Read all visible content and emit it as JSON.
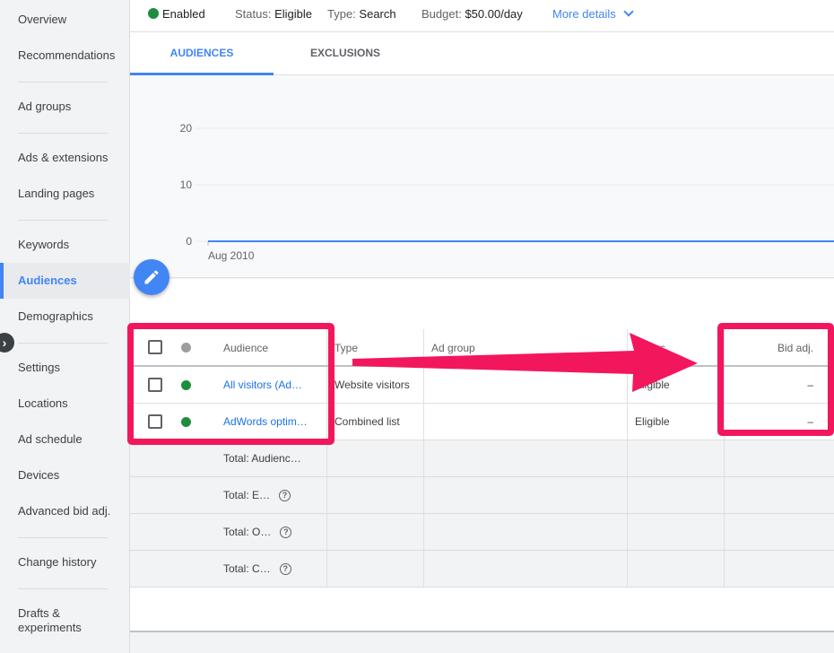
{
  "sidebar": {
    "items": [
      {
        "label": "Overview",
        "active": false
      },
      {
        "label": "Recommendations",
        "active": false
      },
      {
        "label": "Ad groups",
        "active": false
      },
      {
        "label": "Ads & extensions",
        "active": false
      },
      {
        "label": "Landing pages",
        "active": false
      },
      {
        "label": "Keywords",
        "active": false
      },
      {
        "label": "Audiences",
        "active": true
      },
      {
        "label": "Demographics",
        "active": false
      },
      {
        "label": "Settings",
        "active": false
      },
      {
        "label": "Locations",
        "active": false
      },
      {
        "label": "Ad schedule",
        "active": false
      },
      {
        "label": "Devices",
        "active": false
      },
      {
        "label": "Advanced bid adj.",
        "active": false
      },
      {
        "label": "Change history",
        "active": false
      },
      {
        "label": "Drafts & experiments",
        "active": false
      }
    ]
  },
  "summary": {
    "status_enabled": "Enabled",
    "status_label": "Status:",
    "status_value": "Eligible",
    "type_label": "Type:",
    "type_value": "Search",
    "budget_label": "Budget:",
    "budget_value": "$50.00/day",
    "more_details": "More details"
  },
  "tabs": [
    {
      "label": "AUDIENCES",
      "active": true
    },
    {
      "label": "EXCLUSIONS",
      "active": false
    }
  ],
  "chart_data": {
    "type": "line",
    "x": [
      "Aug 2010"
    ],
    "series": [
      {
        "values": [
          0
        ]
      }
    ],
    "yticks": [
      0,
      10,
      20
    ],
    "ylim": [
      0,
      20
    ],
    "tick_labels": {
      "y0": "0",
      "y10": "10",
      "y20": "20",
      "x0": "Aug 2010"
    },
    "line_color": "#4285f4"
  },
  "table": {
    "headers": {
      "audience": "Audience",
      "type": "Type",
      "ad_group": "Ad group",
      "status": "Status",
      "bid_adj": "Bid adj."
    },
    "rows": [
      {
        "audience": "All visitors (Ad…",
        "type": "Website visitors",
        "ad_group": "",
        "status": "Eligible",
        "bid_adj": "–"
      },
      {
        "audience": "AdWords optim…",
        "type": "Combined list",
        "ad_group": "",
        "status": "Eligible",
        "bid_adj": "–"
      }
    ],
    "totals": [
      {
        "label": "Total: Audienc…"
      },
      {
        "label": "Total: E…"
      },
      {
        "label": "Total: O…"
      },
      {
        "label": "Total: C…"
      }
    ]
  },
  "colors": {
    "accent": "#4285f4",
    "enabled_green": "#1e8e3e",
    "annotation_pink": "#f2175d"
  }
}
